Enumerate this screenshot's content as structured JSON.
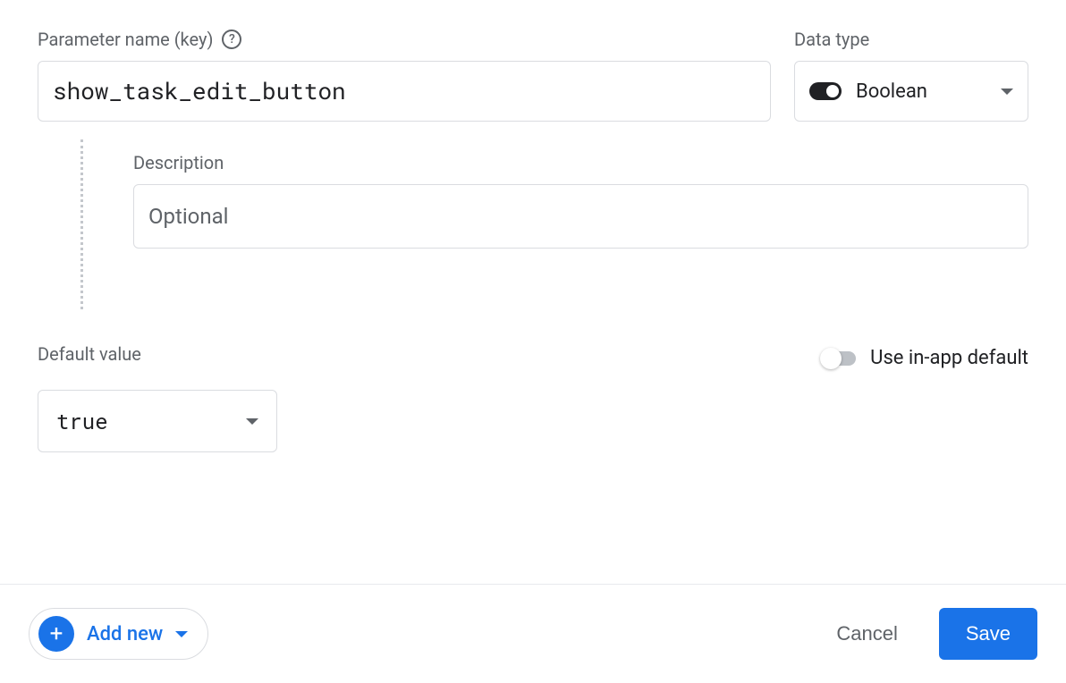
{
  "parameter": {
    "label": "Parameter name (key)",
    "value": "show_task_edit_button"
  },
  "dataType": {
    "label": "Data type",
    "selected": "Boolean"
  },
  "description": {
    "label": "Description",
    "placeholder": "Optional",
    "value": ""
  },
  "defaultValue": {
    "label": "Default value",
    "selected": "true"
  },
  "inAppDefault": {
    "label": "Use in-app default",
    "enabled": false
  },
  "footer": {
    "addNew": "Add new",
    "cancel": "Cancel",
    "save": "Save"
  }
}
